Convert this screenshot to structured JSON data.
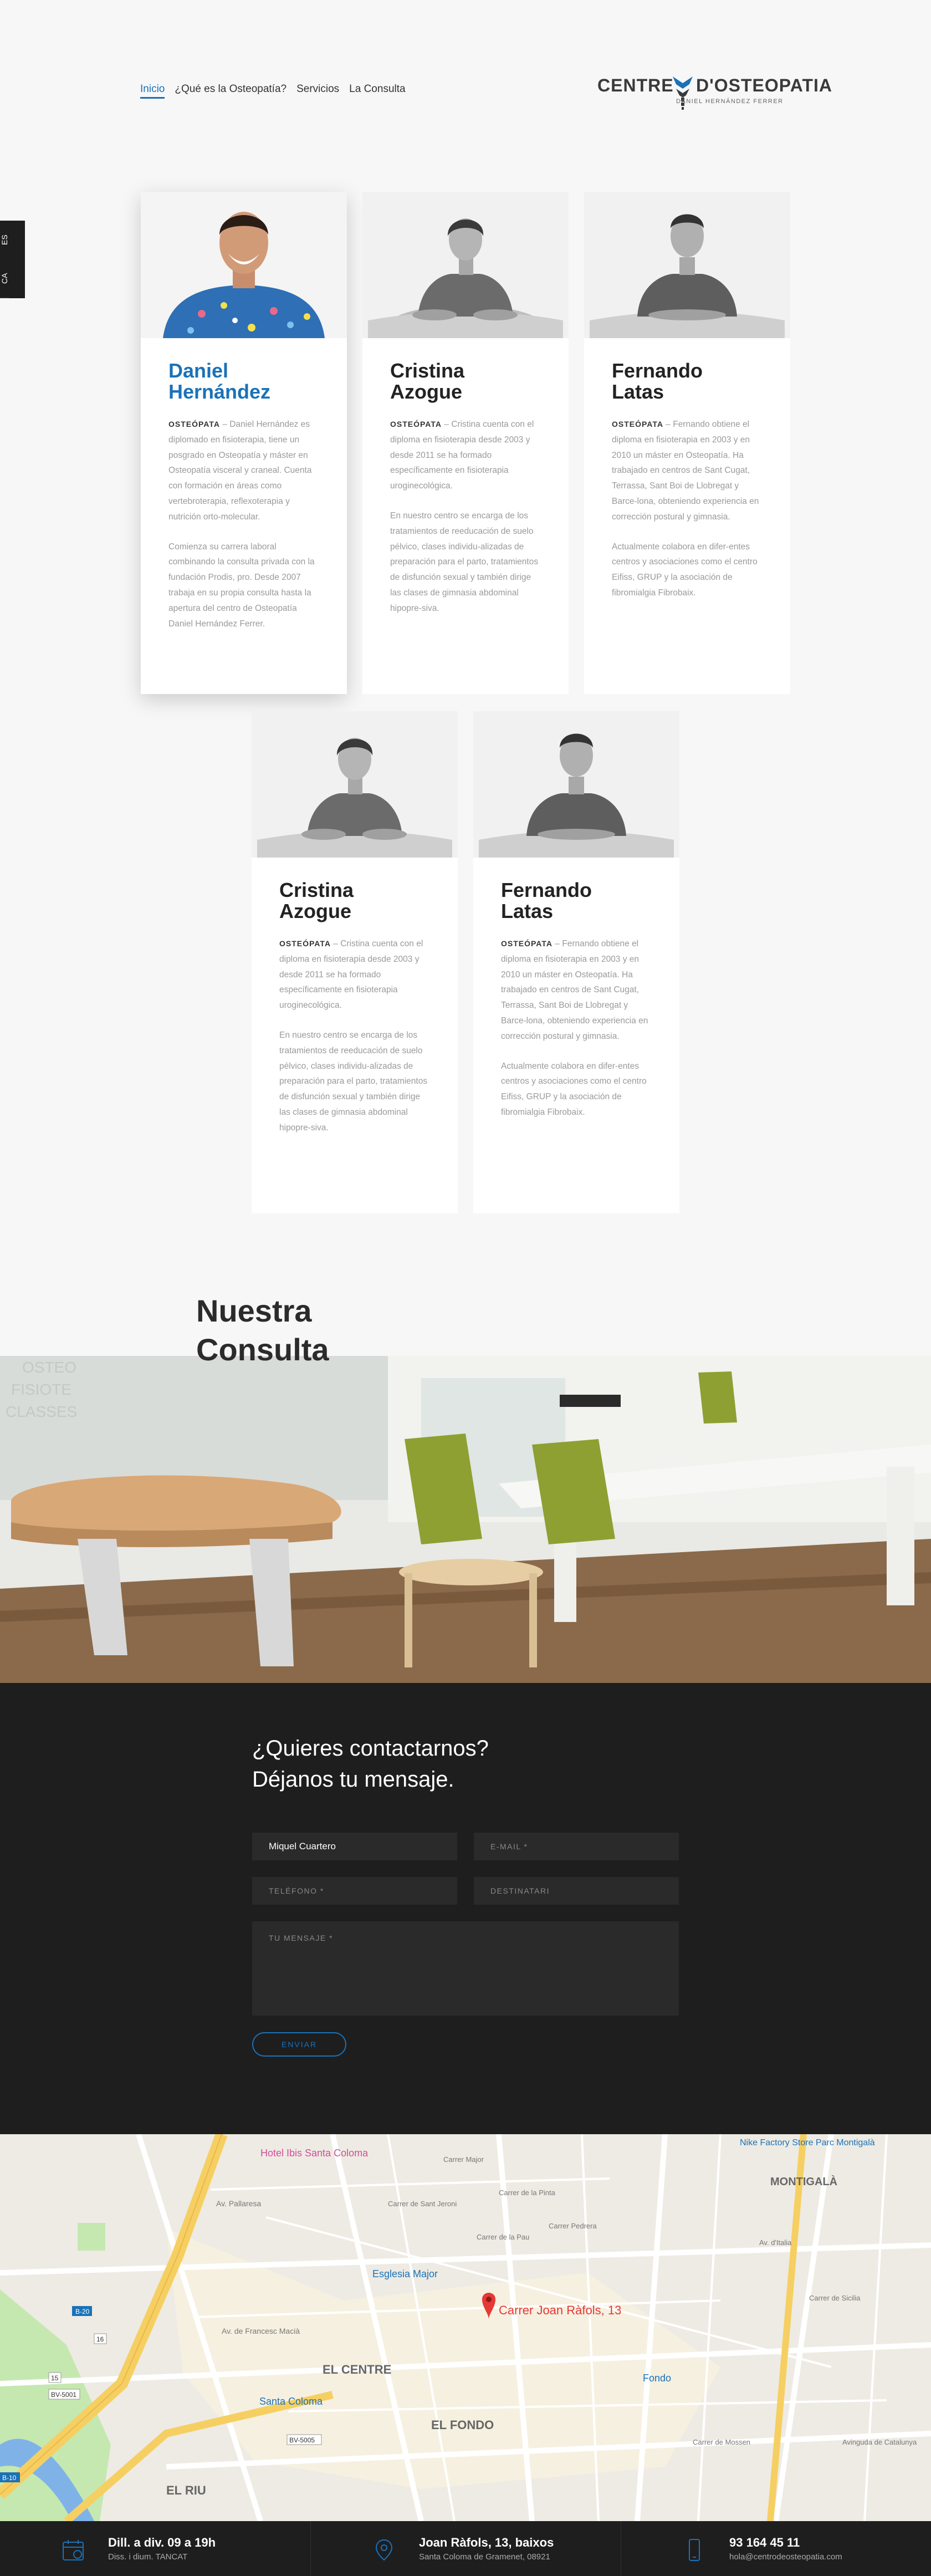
{
  "nav": {
    "items": [
      "Inicio",
      "¿Qué es la Osteopatía?",
      "Servicios",
      "La Consulta"
    ]
  },
  "logo": {
    "word1": "CENTRE",
    "word2": "D'OSTEOPATIA",
    "sub": "DANIEL HERNÁNDEZ FERRER"
  },
  "lang": [
    "ES",
    "CA"
  ],
  "team": [
    {
      "name_line1": "Daniel",
      "name_line2": "Hernández",
      "role": "OSTEÓPATA",
      "p1": "Daniel Hernández es diplomado en fisioterapia, tiene un posgrado en Osteopatía y máster en Osteopatía visceral y craneal. Cuenta con formación en áreas como vertebroterapia, reflexoterapia y nutrición orto-molecular.",
      "p2": "Comienza su carrera laboral combinando la consulta privada con la fundación Prodis, pro. Desde 2007 trabaja en su propia consulta hasta la apertura del centro de Osteopatía Daniel Hernández Ferrer."
    },
    {
      "name_line1": "Cristina",
      "name_line2": "Azogue",
      "role": "OSTEÓPATA",
      "p1": "Cristina cuenta con el diploma en fisioterapia desde 2003 y desde 2011 se ha formado específicamente en fisioterapia uroginecológica.",
      "p2": "En nuestro centro se encarga de los tratamientos de reeducación de suelo pélvico, clases individu-alizadas de preparación para el parto, tratamientos de disfunción sexual y también dirige las clases de gimnasia abdominal hipopre-siva."
    },
    {
      "name_line1": "Fernando",
      "name_line2": "Latas",
      "role": "OSTEÓPATA",
      "p1": "Fernando obtiene el diploma en fisioterapia en 2003 y en 2010 un máster en Osteopatía. Ha trabajado en centros de Sant Cugat, Terrassa, Sant Boi de Llobregat y Barce-lona, obteniendo experiencia en corrección postural y gimnasia.",
      "p2": "Actualmente colabora en difer-entes centros y asociaciones como el centro Eifiss, GRUP y la asociación de fibromialgia Fibrobaix."
    }
  ],
  "consulta": {
    "line1": "Nuestra",
    "line2": "Consulta"
  },
  "contact": {
    "title_line1": "¿Quieres contactarnos?",
    "title_line2": "Déjanos tu mensaje.",
    "name_value": "Miquel Cuartero",
    "email_ph": "E-MAIL *",
    "phone_ph": "TELÉFONO *",
    "dest_ph": "DESTINATARI",
    "msg_ph": "TU MENSAJE *",
    "send": "ENVIAR"
  },
  "map": {
    "pin_label": "Carrer Joan Ràfols, 13",
    "labels": [
      "Hotel Ibis Santa Coloma",
      "Nike Factory Store Parc Montigalà",
      "MONTIGALÀ",
      "Esglesia Major",
      "EL CENTRE",
      "Santa Coloma",
      "Fondo",
      "EL FONDO",
      "EL RIU",
      "Av. Pallaresa",
      "Carrer de la Pau",
      "Carrer Pedrera",
      "Av. de Francesc Macià",
      "Carrer Major",
      "Av. d'Italia",
      "Carrer de Sant Jeroni",
      "Carrer de la Pinta",
      "Avinguda de Catalunya",
      "Carrer de Mossen",
      "Carrer de Sicilia"
    ],
    "roads": [
      "B-20",
      "BV-5001",
      "BV-5005",
      "B-10",
      "16",
      "15"
    ],
    "colors": {
      "highway": "#f6cf62",
      "park": "#c5e8b0",
      "water": "#7fb3e8",
      "pin": "#e53935",
      "transit": "#e53935"
    }
  },
  "footer": [
    {
      "icon": "calendar-icon",
      "line1": "Dill. a div. 09 a 19h",
      "line2": "Diss. i dium. TANCAT"
    },
    {
      "icon": "location-pin-icon",
      "line1": "Joan Ràfols, 13, baixos",
      "line2": "Santa Coloma de Gramenet, 08921"
    },
    {
      "icon": "phone-icon",
      "line1": "93 164 45 11",
      "line2": "hola@centrodeosteopatia.com"
    }
  ],
  "colors": {
    "accent": "#1a72b8",
    "dark": "#1e1e1f",
    "muted": "#9a9a9a"
  }
}
